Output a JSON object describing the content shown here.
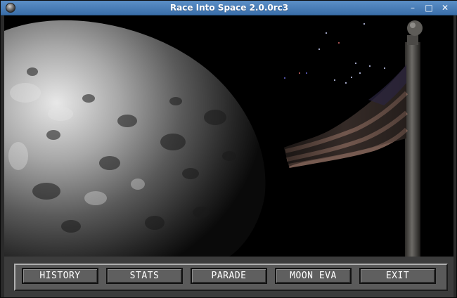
{
  "window": {
    "title": "Race Into Space 2.0.0rc3",
    "controls": {
      "minimize": "–",
      "maximize": "□",
      "close": "✕"
    }
  },
  "scene": {
    "description_icons": [
      "moon-surface",
      "flag-pole",
      "flag"
    ]
  },
  "menu": {
    "buttons": [
      {
        "label": "HISTORY"
      },
      {
        "label": "STATS"
      },
      {
        "label": "PARADE"
      },
      {
        "label": "MOON EVA"
      },
      {
        "label": "EXIT"
      }
    ]
  }
}
